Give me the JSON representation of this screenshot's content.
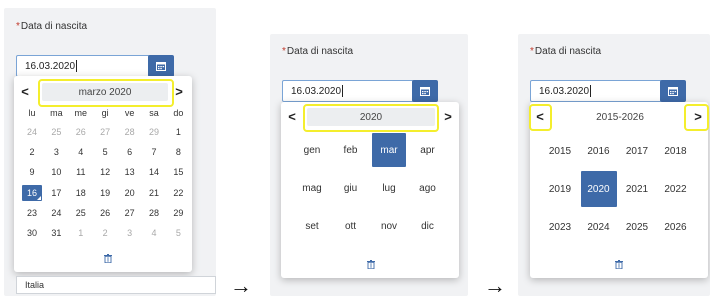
{
  "label": "Data di nascita",
  "input_value": "16.03.2020",
  "step1": {
    "title": "marzo 2020",
    "prev": "<",
    "next": ">",
    "weekdays": [
      "lu",
      "ma",
      "me",
      "gi",
      "ve",
      "sa",
      "do"
    ],
    "weeks": [
      [
        {
          "d": "24",
          "m": true
        },
        {
          "d": "25",
          "m": true
        },
        {
          "d": "26",
          "m": true
        },
        {
          "d": "27",
          "m": true
        },
        {
          "d": "28",
          "m": true
        },
        {
          "d": "29",
          "m": true
        },
        {
          "d": "1"
        }
      ],
      [
        {
          "d": "2"
        },
        {
          "d": "3"
        },
        {
          "d": "4"
        },
        {
          "d": "5"
        },
        {
          "d": "6"
        },
        {
          "d": "7"
        },
        {
          "d": "8"
        }
      ],
      [
        {
          "d": "9"
        },
        {
          "d": "10"
        },
        {
          "d": "11"
        },
        {
          "d": "12"
        },
        {
          "d": "13"
        },
        {
          "d": "14"
        },
        {
          "d": "15"
        }
      ],
      [
        {
          "d": "16",
          "s": true
        },
        {
          "d": "17"
        },
        {
          "d": "18"
        },
        {
          "d": "19"
        },
        {
          "d": "20"
        },
        {
          "d": "21"
        },
        {
          "d": "22"
        }
      ],
      [
        {
          "d": "23"
        },
        {
          "d": "24"
        },
        {
          "d": "25"
        },
        {
          "d": "26"
        },
        {
          "d": "27"
        },
        {
          "d": "28"
        },
        {
          "d": "29"
        }
      ],
      [
        {
          "d": "30"
        },
        {
          "d": "31"
        },
        {
          "d": "1",
          "m": true
        },
        {
          "d": "2",
          "m": true
        },
        {
          "d": "3",
          "m": true
        },
        {
          "d": "4",
          "m": true
        },
        {
          "d": "5",
          "m": true
        }
      ]
    ],
    "country_value": "Italia"
  },
  "step2": {
    "title": "2020",
    "prev": "<",
    "next": ">",
    "months": [
      "gen",
      "feb",
      "mar",
      "apr",
      "mag",
      "giu",
      "lug",
      "ago",
      "set",
      "ott",
      "nov",
      "dic"
    ],
    "selected": "mar"
  },
  "step3": {
    "title": "2015-2026",
    "prev": "<",
    "next": ">",
    "years": [
      "2015",
      "2016",
      "2017",
      "2018",
      "2019",
      "2020",
      "2021",
      "2022",
      "2023",
      "2024",
      "2025",
      "2026"
    ],
    "selected": "2020"
  },
  "arrows": [
    "→",
    "→"
  ],
  "colors": {
    "accent": "#3e6aa8",
    "highlight": "#f4ee2d",
    "required": "#c0392b"
  },
  "icons": {
    "calendar": "calendar-icon",
    "trash": "trash-icon"
  }
}
